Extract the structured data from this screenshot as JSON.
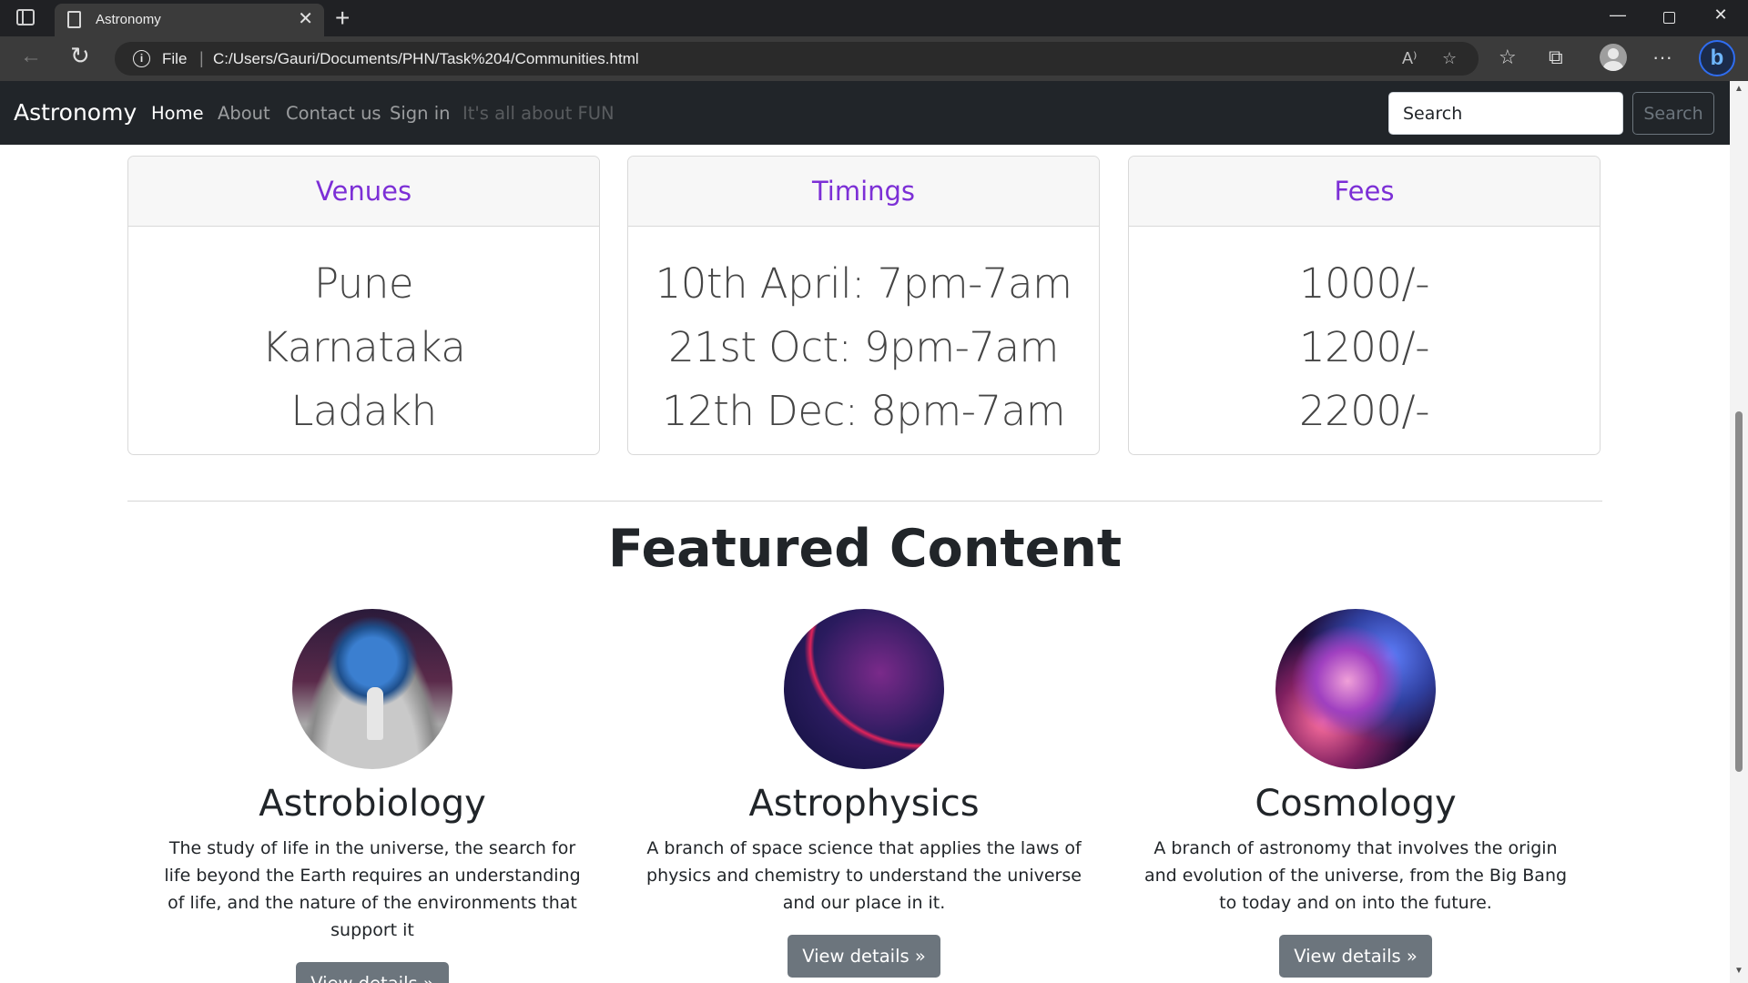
{
  "browser": {
    "tab_title": "Astronomy",
    "file_label": "File",
    "url": "C:/Users/Gauri/Documents/PHN/Task%204/Communities.html"
  },
  "navbar": {
    "brand": "Astronomy",
    "links": [
      "Home",
      "About",
      "Contact us",
      "Sign in",
      "It's all about FUN"
    ],
    "search_placeholder": "Search",
    "search_button": "Search"
  },
  "cards": [
    {
      "header": "Venues",
      "lines": [
        "Pune",
        "Karnataka",
        "Ladakh"
      ]
    },
    {
      "header": "Timings",
      "lines": [
        "10th April: 7pm-7am",
        "21st Oct: 9pm-7am",
        "12th Dec: 8pm-7am"
      ]
    },
    {
      "header": "Fees",
      "lines": [
        "1000/-",
        "1200/-",
        "2200/-"
      ]
    }
  ],
  "featured": {
    "title": "Featured Content",
    "items": [
      {
        "title": "Astrobiology",
        "text": "The study of life in the universe, the search for life beyond the Earth requires an understanding of life, and the nature of the environments that support it",
        "button": "View details »"
      },
      {
        "title": "Astrophysics",
        "text": "A branch of space science that applies the laws of physics and chemistry to understand the universe and our place in it.",
        "button": "View details »"
      },
      {
        "title": "Cosmology",
        "text": "A branch of astronomy that involves the origin and evolution of the universe, from the Big Bang to today and on into the future.",
        "button": "View details »"
      }
    ]
  },
  "colors": {
    "navbar_bg": "#212529",
    "card_header_text": "#7c2fd6",
    "button_bg": "#6c757d"
  }
}
